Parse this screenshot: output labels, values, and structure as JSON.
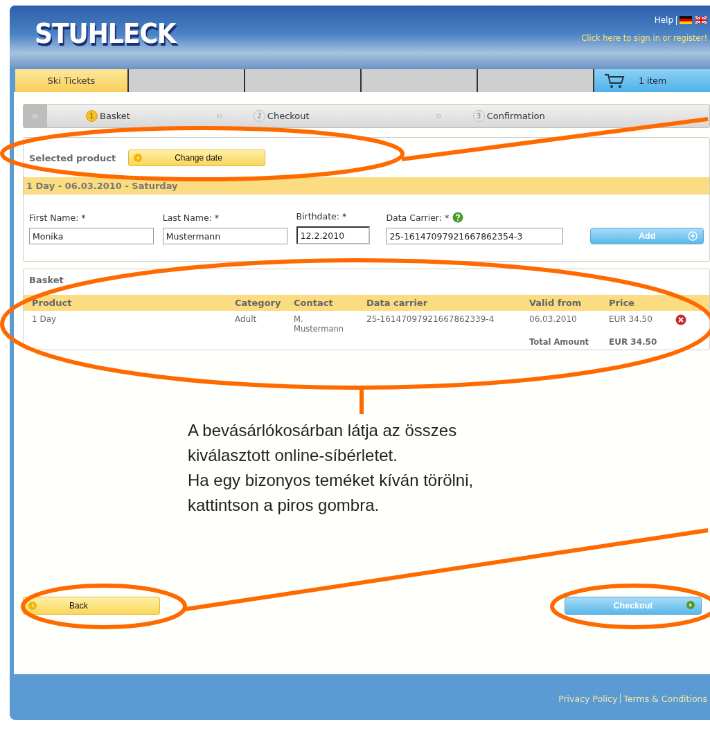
{
  "header": {
    "logo": "STUHLECK",
    "help_link": "Help",
    "sign_in_link": "Click here to sign in or register!"
  },
  "tabs": [
    {
      "label": "Ski Tickets",
      "selected": true
    }
  ],
  "cart": {
    "label": "1 item"
  },
  "steps": [
    {
      "number": "1",
      "label": "Basket",
      "selected": true
    },
    {
      "number": "2",
      "label": "Checkout",
      "selected": false
    },
    {
      "number": "3",
      "label": "Confirmation",
      "selected": false
    }
  ],
  "selected_product": {
    "title": "Selected product",
    "change_date_button": "Change date",
    "date_bar": "1 Day - 06.03.2010 - Saturday",
    "fields": [
      {
        "label": "First Name: *",
        "value": "Monika",
        "focused": false,
        "help": false
      },
      {
        "label": "Last Name: *",
        "value": "Mustermann",
        "focused": false,
        "help": false
      },
      {
        "label": "Birthdate: *",
        "value": "12.2.2010",
        "focused": true,
        "help": false
      },
      {
        "label": "Data Carrier: *",
        "value": "25-16147097921667862354-3",
        "focused": false,
        "help": true
      }
    ],
    "add_button": "Add"
  },
  "basket": {
    "title": "Basket",
    "columns": [
      "Product",
      "Category",
      "Contact",
      "Data carrier",
      "Valid from",
      "Price"
    ],
    "rows": [
      {
        "cells": [
          "1 Day",
          "Adult",
          "M. Mustermann",
          "25-16147097921667862339-4",
          "06.03.2010",
          "EUR 34.50"
        ]
      }
    ],
    "total_label": "Total Amount",
    "total_value": "EUR 34.50"
  },
  "caption": [
    "A bevásárlókosárban látja az összes kiválasztott online-síbérletet.",
    "Ha egy bizonyos teméket kíván törölni, kattintson a piros gombra."
  ],
  "back_button": "Back",
  "checkout_button": "Checkout",
  "footer_links": [
    "Privacy Policy",
    "Terms & Conditions"
  ]
}
